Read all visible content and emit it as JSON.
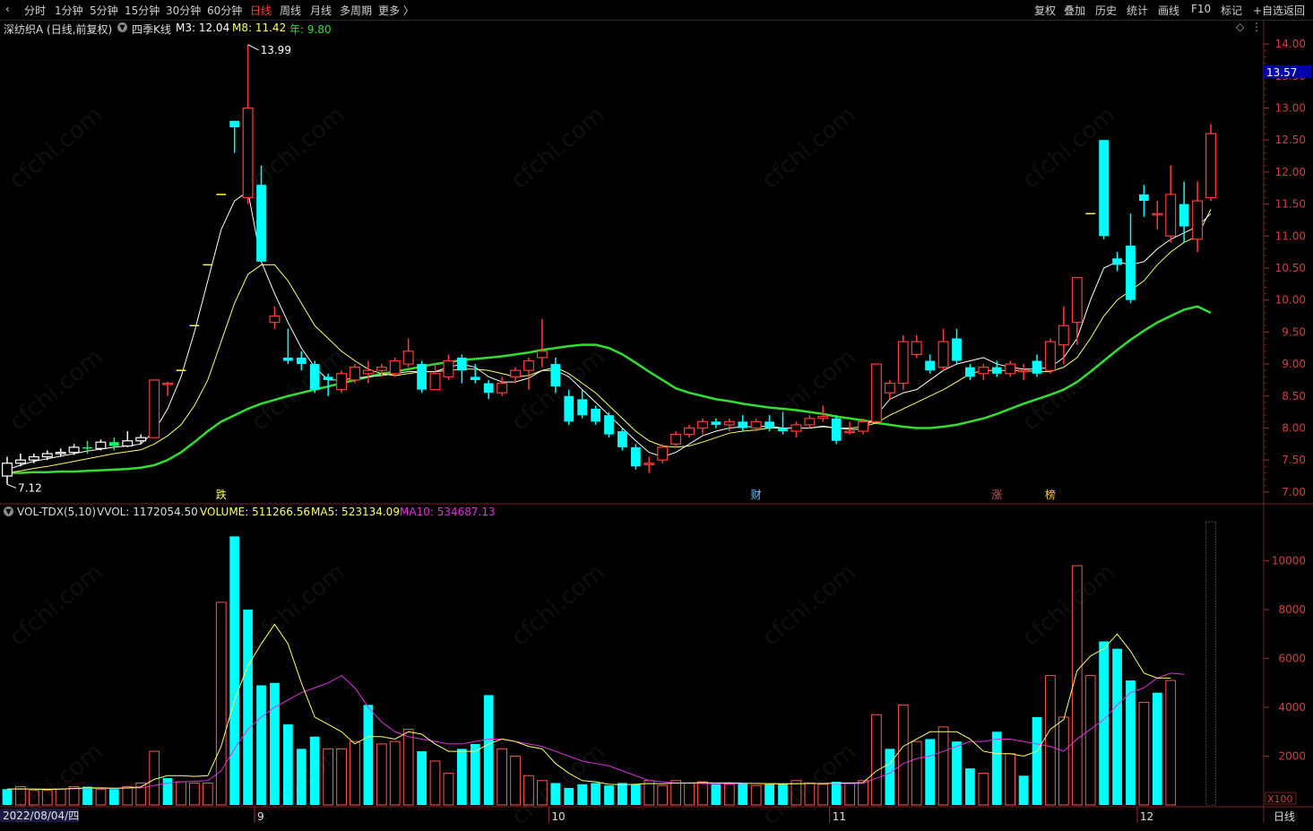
{
  "toolbar": {
    "left": [
      "分时",
      "1分钟",
      "5分钟",
      "15分钟",
      "30分钟",
      "60分钟",
      "日线",
      "周线",
      "月线",
      "多周期",
      "更多 〉"
    ],
    "active": "日线",
    "right": [
      "复权",
      "叠加",
      "历史",
      "统计",
      "画线",
      "F10",
      "标记",
      "+自选",
      "返回"
    ]
  },
  "info": {
    "name": "深纺织A (日线,前复权)",
    "indicator": "四季K线",
    "m3": "M3: 12.04",
    "m8": "M8: 11.42",
    "year": "年: 9.80"
  },
  "vol_info": {
    "name": "VOL-TDX(5,10)",
    "vvol": "VVOL: 1172054.50",
    "volume": "VOLUME: 511266.56",
    "ma5": "MA5: 523134.09",
    "ma10": "MA10: 534687.13"
  },
  "colors": {
    "up": "#ff3b3b",
    "down": "#00ffff",
    "ma_short": "#ffffff",
    "ma_mid": "#ffff66",
    "ma_long": "#33dd33",
    "vol_ma5": "#ffff66",
    "vol_ma10": "#dd33dd",
    "current_price_bg": "#0000aa"
  },
  "price_axis": {
    "ticks": [
      "14.00",
      "13.50",
      "13.00",
      "12.50",
      "12.00",
      "11.50",
      "11.00",
      "10.50",
      "10.00",
      "9.50",
      "9.00",
      "8.50",
      "8.00",
      "7.50",
      "7.00"
    ],
    "current": "13.57"
  },
  "vol_axis": {
    "ticks": [
      "10000",
      "8000",
      "6000",
      "4000",
      "2000"
    ],
    "unit": "X100"
  },
  "date_axis": {
    "start": "2022/08/04/四",
    "months": [
      "9",
      "10",
      "11",
      "12"
    ]
  },
  "period": "日线",
  "markers": {
    "high": "13.99",
    "low": "7.12",
    "events": [
      "跌",
      "财",
      "涨",
      "榜"
    ]
  },
  "watermark": "cfchi.com",
  "chart_data": {
    "type": "candlestick",
    "ylim": [
      6.9,
      14.1
    ],
    "candles": [
      [
        7.25,
        7.45,
        7.12,
        7.55
      ],
      [
        7.45,
        7.5,
        7.4,
        7.6
      ],
      [
        7.5,
        7.55,
        7.45,
        7.6
      ],
      [
        7.55,
        7.6,
        7.5,
        7.65
      ],
      [
        7.6,
        7.62,
        7.55,
        7.68
      ],
      [
        7.62,
        7.7,
        7.58,
        7.75
      ],
      [
        7.7,
        7.68,
        7.6,
        7.8
      ],
      [
        7.68,
        7.78,
        7.65,
        7.82
      ],
      [
        7.78,
        7.72,
        7.65,
        7.85
      ],
      [
        7.72,
        7.8,
        7.7,
        7.95
      ],
      [
        7.8,
        7.85,
        7.75,
        7.9
      ],
      [
        7.85,
        8.75,
        7.85,
        8.75
      ],
      [
        8.7,
        8.7,
        8.5,
        8.72
      ],
      [
        8.9,
        8.9,
        8.9,
        8.9
      ],
      [
        9.6,
        9.6,
        9.6,
        9.6
      ],
      [
        10.55,
        10.55,
        10.55,
        10.55
      ],
      [
        11.65,
        11.65,
        11.65,
        11.65
      ],
      [
        12.8,
        12.7,
        12.3,
        12.8
      ],
      [
        11.6,
        13.0,
        11.5,
        13.99
      ],
      [
        11.8,
        10.6,
        10.6,
        12.1
      ],
      [
        9.65,
        9.75,
        9.55,
        9.9
      ],
      [
        9.1,
        9.05,
        9.0,
        9.55
      ],
      [
        9.1,
        9.0,
        8.9,
        9.2
      ],
      [
        9.0,
        8.6,
        8.55,
        9.05
      ],
      [
        8.8,
        8.75,
        8.5,
        8.85
      ],
      [
        8.6,
        8.85,
        8.55,
        8.9
      ],
      [
        8.75,
        8.95,
        8.7,
        9.0
      ],
      [
        8.85,
        8.9,
        8.7,
        9.05
      ],
      [
        8.9,
        8.95,
        8.8,
        9.0
      ],
      [
        8.85,
        9.05,
        8.8,
        9.1
      ],
      [
        9.0,
        9.2,
        8.95,
        9.4
      ],
      [
        9.0,
        8.6,
        8.55,
        9.05
      ],
      [
        8.6,
        8.85,
        8.6,
        9.0
      ],
      [
        8.8,
        9.05,
        8.75,
        9.15
      ],
      [
        9.1,
        8.9,
        8.7,
        9.15
      ],
      [
        8.8,
        8.75,
        8.7,
        9.0
      ],
      [
        8.7,
        8.55,
        8.45,
        8.75
      ],
      [
        8.55,
        8.7,
        8.5,
        8.8
      ],
      [
        8.8,
        8.9,
        8.7,
        8.95
      ],
      [
        8.9,
        9.05,
        8.6,
        9.1
      ],
      [
        9.1,
        9.2,
        8.95,
        9.7
      ],
      [
        9.0,
        8.65,
        8.55,
        9.1
      ],
      [
        8.5,
        8.1,
        8.05,
        8.6
      ],
      [
        8.45,
        8.2,
        8.15,
        8.6
      ],
      [
        8.3,
        8.1,
        8.05,
        8.35
      ],
      [
        8.2,
        7.9,
        7.85,
        8.25
      ],
      [
        7.95,
        7.7,
        7.65,
        8.0
      ],
      [
        7.7,
        7.4,
        7.35,
        7.75
      ],
      [
        7.45,
        7.45,
        7.3,
        7.55
      ],
      [
        7.5,
        7.7,
        7.45,
        7.75
      ],
      [
        7.75,
        7.9,
        7.7,
        7.95
      ],
      [
        7.9,
        8.0,
        7.85,
        8.05
      ],
      [
        8.0,
        8.1,
        7.9,
        8.15
      ],
      [
        8.1,
        8.05,
        8.0,
        8.15
      ],
      [
        8.05,
        8.1,
        7.95,
        8.15
      ],
      [
        8.1,
        8.0,
        7.95,
        8.2
      ],
      [
        8.0,
        8.1,
        7.95,
        8.15
      ],
      [
        8.1,
        8.0,
        7.95,
        8.2
      ],
      [
        8.0,
        7.95,
        7.9,
        8.25
      ],
      [
        7.95,
        8.05,
        7.85,
        8.1
      ],
      [
        8.05,
        8.15,
        8.0,
        8.2
      ],
      [
        8.15,
        8.18,
        8.1,
        8.35
      ],
      [
        8.15,
        7.8,
        7.75,
        8.2
      ],
      [
        7.95,
        7.95,
        7.9,
        8.1
      ],
      [
        7.95,
        8.1,
        7.9,
        8.15
      ],
      [
        8.1,
        9.0,
        8.1,
        9.0
      ],
      [
        8.55,
        8.7,
        8.45,
        8.75
      ],
      [
        8.7,
        9.35,
        8.6,
        9.45
      ],
      [
        9.15,
        9.35,
        9.1,
        9.45
      ],
      [
        9.05,
        8.9,
        8.85,
        9.15
      ],
      [
        8.95,
        9.35,
        8.9,
        9.55
      ],
      [
        9.4,
        9.05,
        9.0,
        9.55
      ],
      [
        8.95,
        8.8,
        8.75,
        9.0
      ],
      [
        8.85,
        8.95,
        8.75,
        9.0
      ],
      [
        8.95,
        8.85,
        8.8,
        9.05
      ],
      [
        8.85,
        9.0,
        8.8,
        9.05
      ],
      [
        8.9,
        8.9,
        8.75,
        9.0
      ],
      [
        9.05,
        8.85,
        8.8,
        9.15
      ],
      [
        8.9,
        9.35,
        8.85,
        9.4
      ],
      [
        9.3,
        9.6,
        9.0,
        9.9
      ],
      [
        9.65,
        10.35,
        9.3,
        10.35
      ],
      [
        11.35,
        11.35,
        11.35,
        11.35
      ],
      [
        12.5,
        11.0,
        10.95,
        12.5
      ],
      [
        10.65,
        10.55,
        10.45,
        10.75
      ],
      [
        10.85,
        10.0,
        9.95,
        11.35
      ],
      [
        11.65,
        11.55,
        11.3,
        11.8
      ],
      [
        11.35,
        11.35,
        11.1,
        11.55
      ],
      [
        11.0,
        11.65,
        10.9,
        12.1
      ],
      [
        11.5,
        11.15,
        10.9,
        11.85
      ],
      [
        10.95,
        11.55,
        10.75,
        11.85
      ],
      [
        11.6,
        12.6,
        11.55,
        12.75
      ]
    ],
    "ma_short": [
      7.35,
      7.42,
      7.48,
      7.52,
      7.56,
      7.6,
      7.64,
      7.67,
      7.7,
      7.72,
      7.75,
      7.95,
      8.3,
      8.8,
      9.5,
      10.3,
      11.1,
      11.55,
      11.7,
      10.6,
      10.1,
      9.65,
      9.25,
      8.95,
      8.75,
      8.75,
      8.78,
      8.8,
      8.82,
      8.85,
      8.88,
      8.88,
      8.88,
      8.95,
      9.0,
      8.95,
      8.8,
      8.72,
      8.72,
      8.78,
      8.9,
      8.9,
      8.8,
      8.6,
      8.4,
      8.2,
      8.0,
      7.8,
      7.62,
      7.55,
      7.62,
      7.75,
      7.88,
      7.95,
      8.0,
      8.02,
      8.02,
      8.03,
      8.0,
      8.0,
      8.0,
      8.03,
      8.0,
      7.98,
      7.98,
      8.2,
      8.45,
      8.55,
      8.6,
      8.75,
      8.9,
      9.0,
      9.05,
      9.1,
      9.0,
      8.95,
      8.92,
      8.92,
      8.95,
      9.1,
      9.4,
      10.0,
      10.5,
      10.6,
      10.55,
      10.6,
      10.8,
      10.95,
      11.05,
      11.15,
      11.35
    ],
    "ma_mid": [
      7.3,
      7.33,
      7.37,
      7.4,
      7.44,
      7.48,
      7.52,
      7.56,
      7.6,
      7.63,
      7.66,
      7.75,
      7.88,
      8.05,
      8.35,
      8.75,
      9.35,
      9.95,
      10.4,
      10.55,
      10.55,
      10.3,
      9.95,
      9.6,
      9.4,
      9.2,
      9.05,
      8.92,
      8.85,
      8.82,
      8.85,
      8.88,
      8.88,
      8.9,
      8.92,
      8.92,
      8.9,
      8.85,
      8.8,
      8.82,
      8.9,
      8.95,
      8.85,
      8.7,
      8.55,
      8.35,
      8.15,
      7.95,
      7.8,
      7.72,
      7.7,
      7.72,
      7.78,
      7.85,
      7.92,
      7.95,
      7.97,
      8.0,
      8.0,
      8.0,
      8.0,
      8.02,
      8.0,
      8.0,
      8.02,
      8.08,
      8.2,
      8.3,
      8.4,
      8.5,
      8.6,
      8.72,
      8.85,
      8.9,
      8.9,
      8.9,
      8.9,
      8.88,
      8.88,
      8.95,
      9.1,
      9.4,
      9.75,
      10.0,
      10.15,
      10.3,
      10.55,
      10.75,
      10.9,
      11.0,
      11.42
    ],
    "ma_long": [
      7.3,
      7.3,
      7.31,
      7.31,
      7.32,
      7.32,
      7.33,
      7.34,
      7.35,
      7.36,
      7.38,
      7.42,
      7.5,
      7.62,
      7.78,
      7.95,
      8.1,
      8.2,
      8.3,
      8.38,
      8.44,
      8.5,
      8.55,
      8.6,
      8.65,
      8.7,
      8.75,
      8.8,
      8.85,
      8.88,
      8.92,
      8.96,
      9.0,
      9.03,
      9.06,
      9.08,
      9.1,
      9.12,
      9.15,
      9.18,
      9.22,
      9.25,
      9.28,
      9.3,
      9.3,
      9.25,
      9.15,
      9.02,
      8.88,
      8.75,
      8.62,
      8.55,
      8.5,
      8.45,
      8.42,
      8.38,
      8.35,
      8.32,
      8.3,
      8.28,
      8.25,
      8.22,
      8.18,
      8.15,
      8.12,
      8.08,
      8.05,
      8.02,
      8.0,
      8.0,
      8.02,
      8.05,
      8.1,
      8.15,
      8.22,
      8.3,
      8.38,
      8.45,
      8.52,
      8.6,
      8.72,
      8.88,
      9.05,
      9.22,
      9.38,
      9.52,
      9.65,
      9.75,
      9.85,
      9.9,
      9.8
    ],
    "volume": [
      650,
      750,
      600,
      600,
      650,
      750,
      750,
      650,
      650,
      750,
      900,
      2200,
      1100,
      950,
      900,
      900,
      8300,
      11000,
      8000,
      4900,
      5000,
      3300,
      2300,
      2800,
      2300,
      2300,
      2600,
      4100,
      2500,
      2600,
      3100,
      2200,
      1800,
      1300,
      2300,
      2500,
      4500,
      2300,
      2000,
      1200,
      1000,
      900,
      700,
      850,
      900,
      800,
      900,
      850,
      1000,
      800,
      1000,
      900,
      950,
      850,
      850,
      900,
      800,
      850,
      850,
      1000,
      900,
      850,
      950,
      900,
      1000,
      3700,
      2300,
      4100,
      2600,
      2700,
      3200,
      2600,
      1500,
      1300,
      3000,
      2100,
      1200,
      3600,
      5300,
      3600,
      9800,
      5300,
      6700,
      6400,
      5100,
      4200,
      4600,
      5100
    ],
    "vol_up": [
      false,
      true,
      true,
      true,
      true,
      true,
      false,
      true,
      false,
      true,
      true,
      true,
      false,
      true,
      true,
      true,
      true,
      false,
      false,
      false,
      false,
      false,
      false,
      false,
      true,
      true,
      true,
      false,
      true,
      true,
      true,
      false,
      true,
      true,
      false,
      false,
      false,
      true,
      true,
      true,
      true,
      false,
      false,
      false,
      false,
      false,
      false,
      false,
      true,
      true,
      true,
      true,
      true,
      false,
      true,
      false,
      true,
      false,
      false,
      true,
      true,
      true,
      false,
      true,
      true,
      true,
      false,
      true,
      true,
      false,
      true,
      false,
      false,
      true,
      false,
      true,
      false,
      false,
      true,
      true,
      true,
      true,
      false,
      false,
      false,
      true,
      false,
      true,
      false,
      true,
      true
    ],
    "vol_ma5": [
      650,
      660,
      650,
      640,
      650,
      680,
      700,
      700,
      690,
      700,
      740,
      1050,
      1200,
      1200,
      1170,
      1200,
      2400,
      4300,
      5700,
      6600,
      7400,
      6600,
      5000,
      3600,
      3300,
      3000,
      2500,
      2800,
      2800,
      2700,
      3000,
      2900,
      2500,
      2200,
      2200,
      2200,
      2500,
      2700,
      2600,
      2400,
      2300,
      1700,
      1300,
      1000,
      950,
      850,
      830,
      850,
      880,
      870,
      900,
      900,
      920,
      900,
      910,
      890,
      880,
      870,
      860,
      870,
      880,
      880,
      900,
      900,
      920,
      1400,
      1700,
      2400,
      2700,
      3000,
      3000,
      3000,
      2700,
      2200,
      2100,
      2100,
      2000,
      2200,
      3100,
      3500,
      5500,
      6100,
      6400,
      7000,
      6300,
      5400,
      5200,
      5200
    ],
    "vol_ma10": [
      650,
      650,
      655,
      655,
      660,
      665,
      670,
      680,
      685,
      690,
      700,
      800,
      900,
      950,
      970,
      1000,
      1400,
      2300,
      3100,
      3600,
      4000,
      4300,
      4600,
      4800,
      5000,
      5300,
      4800,
      4000,
      3400,
      3000,
      2800,
      2700,
      2600,
      2500,
      2500,
      2600,
      2700,
      2700,
      2600,
      2500,
      2400,
      2200,
      2000,
      1800,
      1700,
      1600,
      1400,
      1200,
      1000,
      950,
      900,
      900,
      880,
      880,
      880,
      880,
      880,
      880,
      880,
      880,
      880,
      880,
      880,
      880,
      890,
      1100,
      1300,
      1700,
      1900,
      2000,
      2200,
      2400,
      2600,
      2600,
      2700,
      2700,
      2600,
      2500,
      2400,
      2200,
      2700,
      3100,
      3500,
      4100,
      4600,
      4800,
      5200,
      5400,
      5350
    ]
  }
}
